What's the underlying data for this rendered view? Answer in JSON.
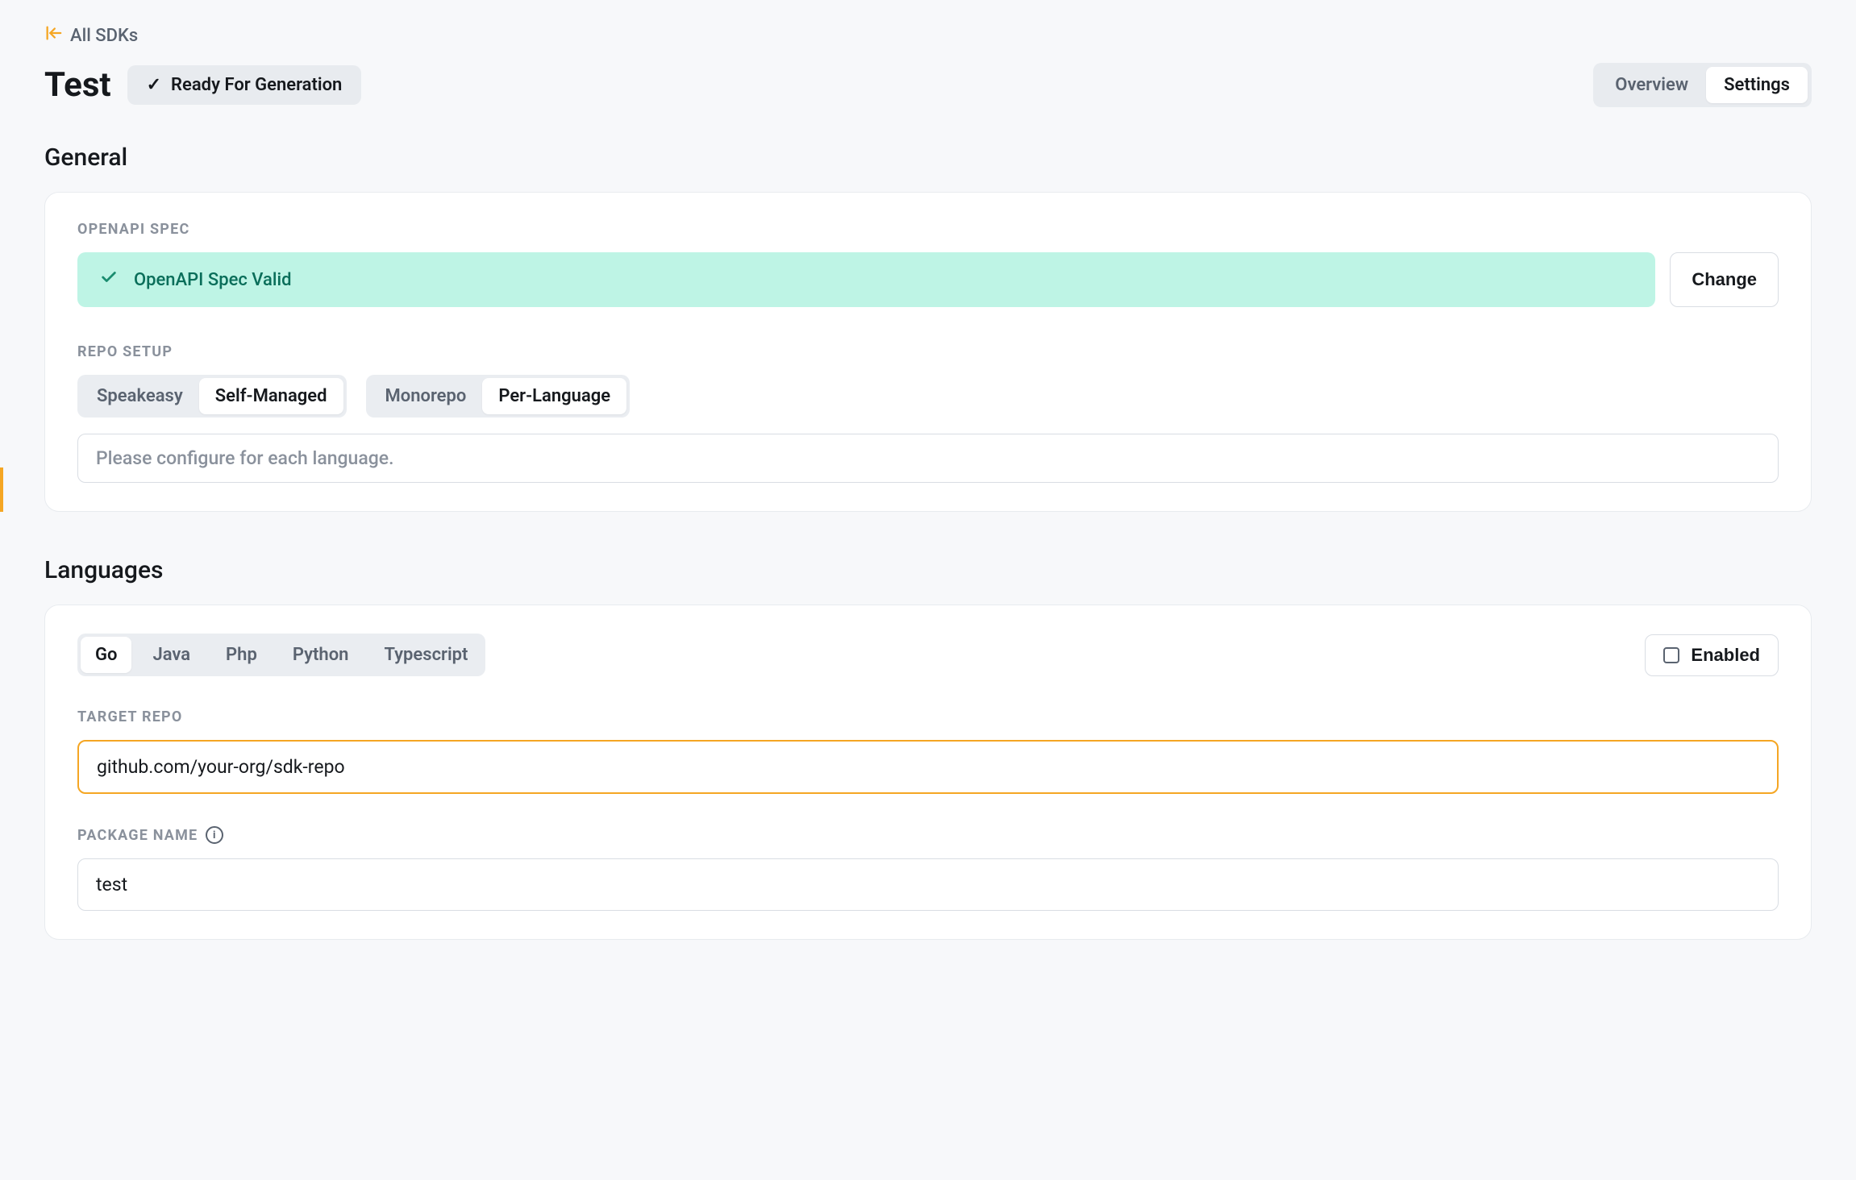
{
  "breadcrumb": {
    "link": "All SDKs"
  },
  "header": {
    "title": "Test",
    "status": "Ready For Generation",
    "tabs": {
      "overview": "Overview",
      "settings": "Settings"
    }
  },
  "sections": {
    "general": {
      "title": "General",
      "openapi": {
        "label": "OPENAPI SPEC",
        "status": "OpenAPI Spec Valid",
        "change_button": "Change"
      },
      "repo_setup": {
        "label": "REPO SETUP",
        "management": {
          "speakeasy": "Speakeasy",
          "self_managed": "Self-Managed"
        },
        "structure": {
          "monorepo": "Monorepo",
          "per_language": "Per-Language"
        },
        "note": "Please configure for each language."
      }
    },
    "languages": {
      "title": "Languages",
      "tabs": {
        "go": "Go",
        "java": "Java",
        "php": "Php",
        "python": "Python",
        "typescript": "Typescript"
      },
      "enabled_button": "Enabled",
      "target_repo": {
        "label": "TARGET REPO",
        "value": "github.com/your-org/sdk-repo"
      },
      "package_name": {
        "label": "PACKAGE NAME",
        "value": "test"
      }
    }
  }
}
